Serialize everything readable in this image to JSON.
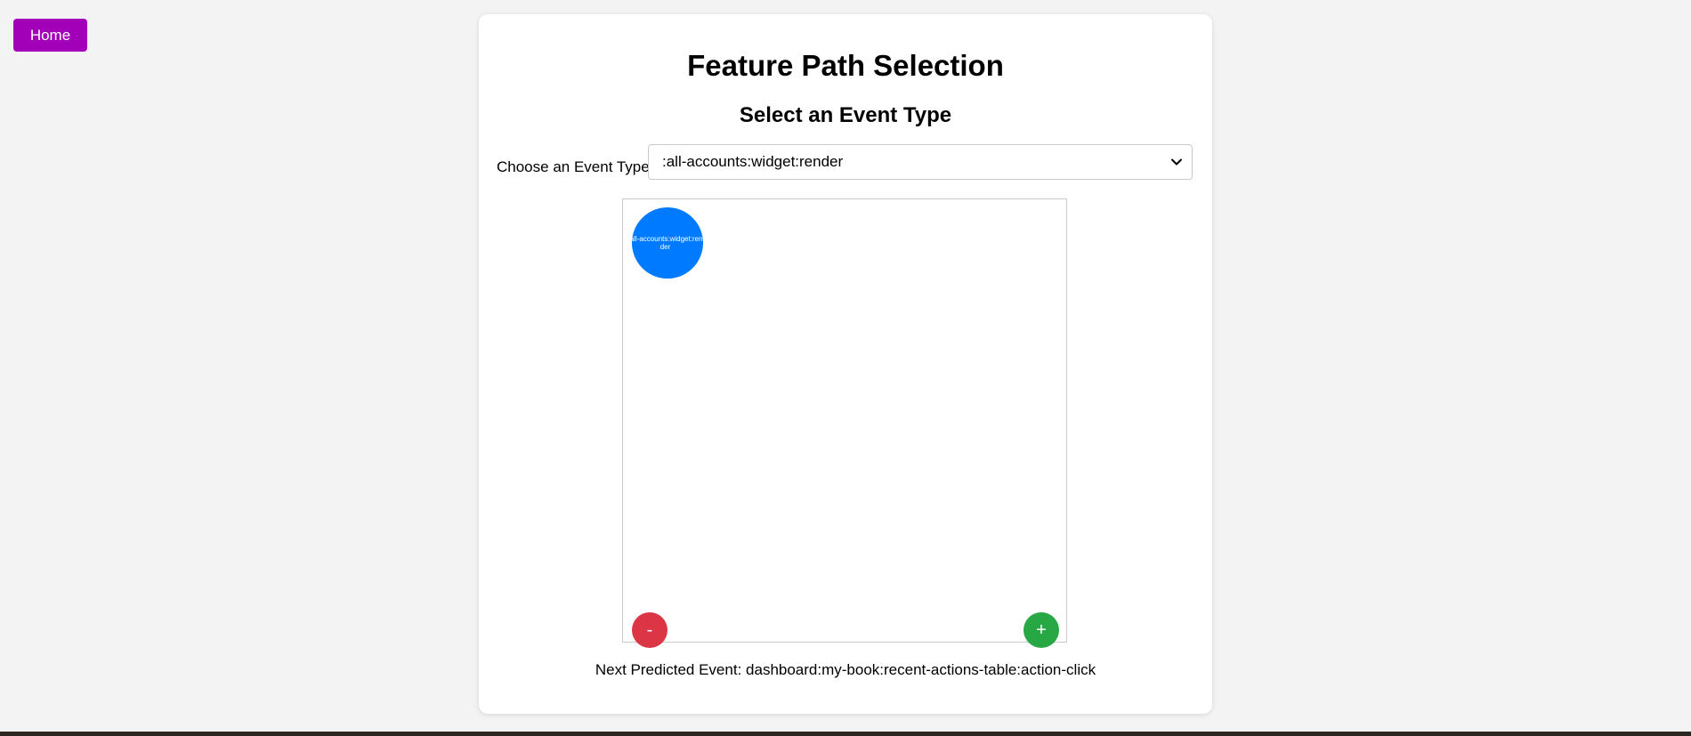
{
  "nav": {
    "home_label": "Home"
  },
  "page": {
    "title": "Feature Path Selection",
    "subtitle": "Select an Event Type"
  },
  "event_select": {
    "label": "Choose an Event Type:",
    "selected_value": ":all-accounts:widget:render",
    "icon": "chevron-down-icon"
  },
  "graph": {
    "nodes": [
      {
        "label": ":all-accounts:widget:render"
      }
    ],
    "zoom_out_label": "-",
    "zoom_in_label": "+"
  },
  "prediction": {
    "label": "Next Predicted Event:",
    "value": "dashboard:my-book:recent-actions-table:action-click"
  },
  "colors": {
    "home_button": "#a100b8",
    "node": "#007bff",
    "zoom_out": "#dc3545",
    "zoom_in": "#28a745",
    "background": "#f3f3f3"
  }
}
